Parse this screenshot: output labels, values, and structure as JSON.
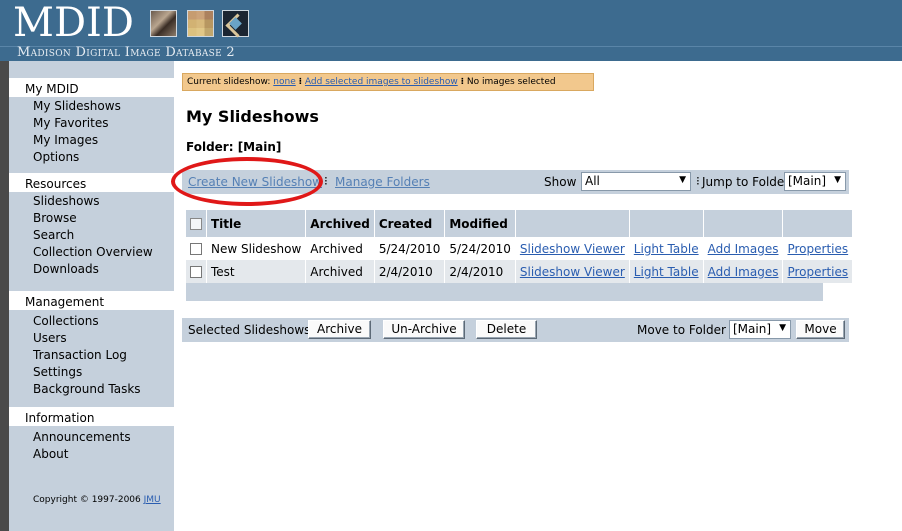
{
  "header": {
    "logo_text": "MDID",
    "subtitle": "Madison Digital Image Database 2"
  },
  "sidebar": {
    "groups": [
      {
        "title": "My MDID",
        "items": [
          "My Slideshows",
          "My Favorites",
          "My Images",
          "Options"
        ]
      },
      {
        "title": "Resources",
        "items": [
          "Slideshows",
          "Browse",
          "Search",
          "Collection Overview",
          "Downloads"
        ]
      },
      {
        "title": "Management",
        "items": [
          "Collections",
          "Users",
          "Transaction Log",
          "Settings",
          "Background Tasks"
        ]
      },
      {
        "title": "Information",
        "items": [
          "Announcements",
          "About"
        ]
      }
    ],
    "copyright": "Copyright © 1997-2006",
    "copyright_link": "JMU"
  },
  "status": {
    "label": "Current slideshow:",
    "current": "none",
    "add_link": "Add selected images to slideshow",
    "selected": "No images selected"
  },
  "main": {
    "title": "My Slideshows",
    "folder": "Folder: [Main]"
  },
  "toolbar": {
    "create": "Create New Slideshow",
    "manage": "Manage Folders",
    "show_label": "Show",
    "show_value": "All",
    "jump_label": "Jump to Folder",
    "jump_value": "[Main]"
  },
  "table": {
    "headers": [
      "Title",
      "Archived",
      "Created",
      "Modified"
    ],
    "rows": [
      {
        "title": "New Slideshow",
        "archived": "Archived",
        "created": "5/24/2010",
        "modified": "5/24/2010"
      },
      {
        "title": "Test",
        "archived": "Archived",
        "created": "2/4/2010",
        "modified": "2/4/2010"
      }
    ],
    "row_links": [
      "Slideshow Viewer",
      "Light Table",
      "Add Images",
      "Properties"
    ]
  },
  "actions": {
    "label": "Selected Slideshows:",
    "archive": "Archive",
    "unarchive": "Un-Archive",
    "delete": "Delete",
    "move_label": "Move to Folder",
    "move_value": "[Main]",
    "move": "Move"
  },
  "colors": {
    "header_bg": "#3d6b8f",
    "sidebar_bg": "#c5d0dc",
    "status_bg": "#f2c88d",
    "highlight": "#e01818",
    "link": "#2a5db0"
  }
}
